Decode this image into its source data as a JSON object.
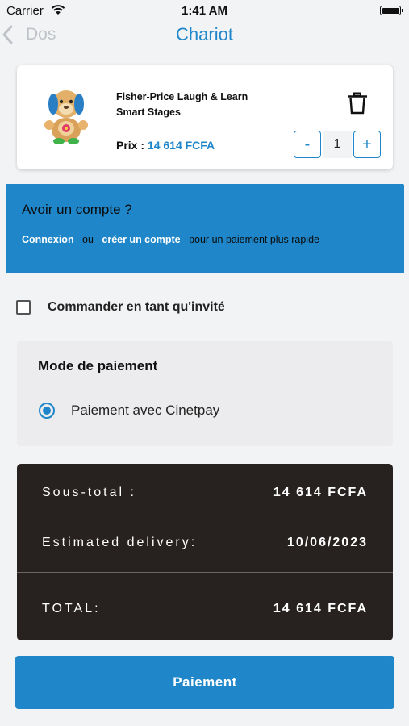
{
  "status_bar": {
    "carrier": "Carrier",
    "time": "1:41 AM"
  },
  "nav": {
    "back_label": "Dos",
    "title": "Chariot"
  },
  "cart_item": {
    "name": "Fisher-Price Laugh & Learn Smart Stages",
    "price_label": "Prix :",
    "price_value": "14 614 FCFA",
    "quantity": "1",
    "minus_label": "-",
    "plus_label": "+",
    "image_icon": "toy-puppy-image",
    "delete_icon": "trash-icon"
  },
  "account": {
    "title": "Avoir un compte ?",
    "login_link": "Connexion",
    "or_text": "ou",
    "signup_link": "créer un compte",
    "suffix_text": "pour un paiement plus rapide"
  },
  "guest": {
    "label": "Commander en tant qu'invité",
    "checked": false
  },
  "payment": {
    "title": "Mode de paiement",
    "option_label": "Paiement avec Cinetpay",
    "selected": true
  },
  "summary": {
    "subtotal_label": "Sous-total :",
    "subtotal_value": "14 614 FCFA",
    "delivery_label": "Estimated delivery:",
    "delivery_value": "10/06/2023",
    "total_label": "TOTAL:",
    "total_value": "14 614 FCFA"
  },
  "pay_button": {
    "label": "Paiement"
  },
  "colors": {
    "accent": "#1f87c9",
    "summary_bg": "#27221f",
    "page_bg": "#f2f3f5"
  }
}
